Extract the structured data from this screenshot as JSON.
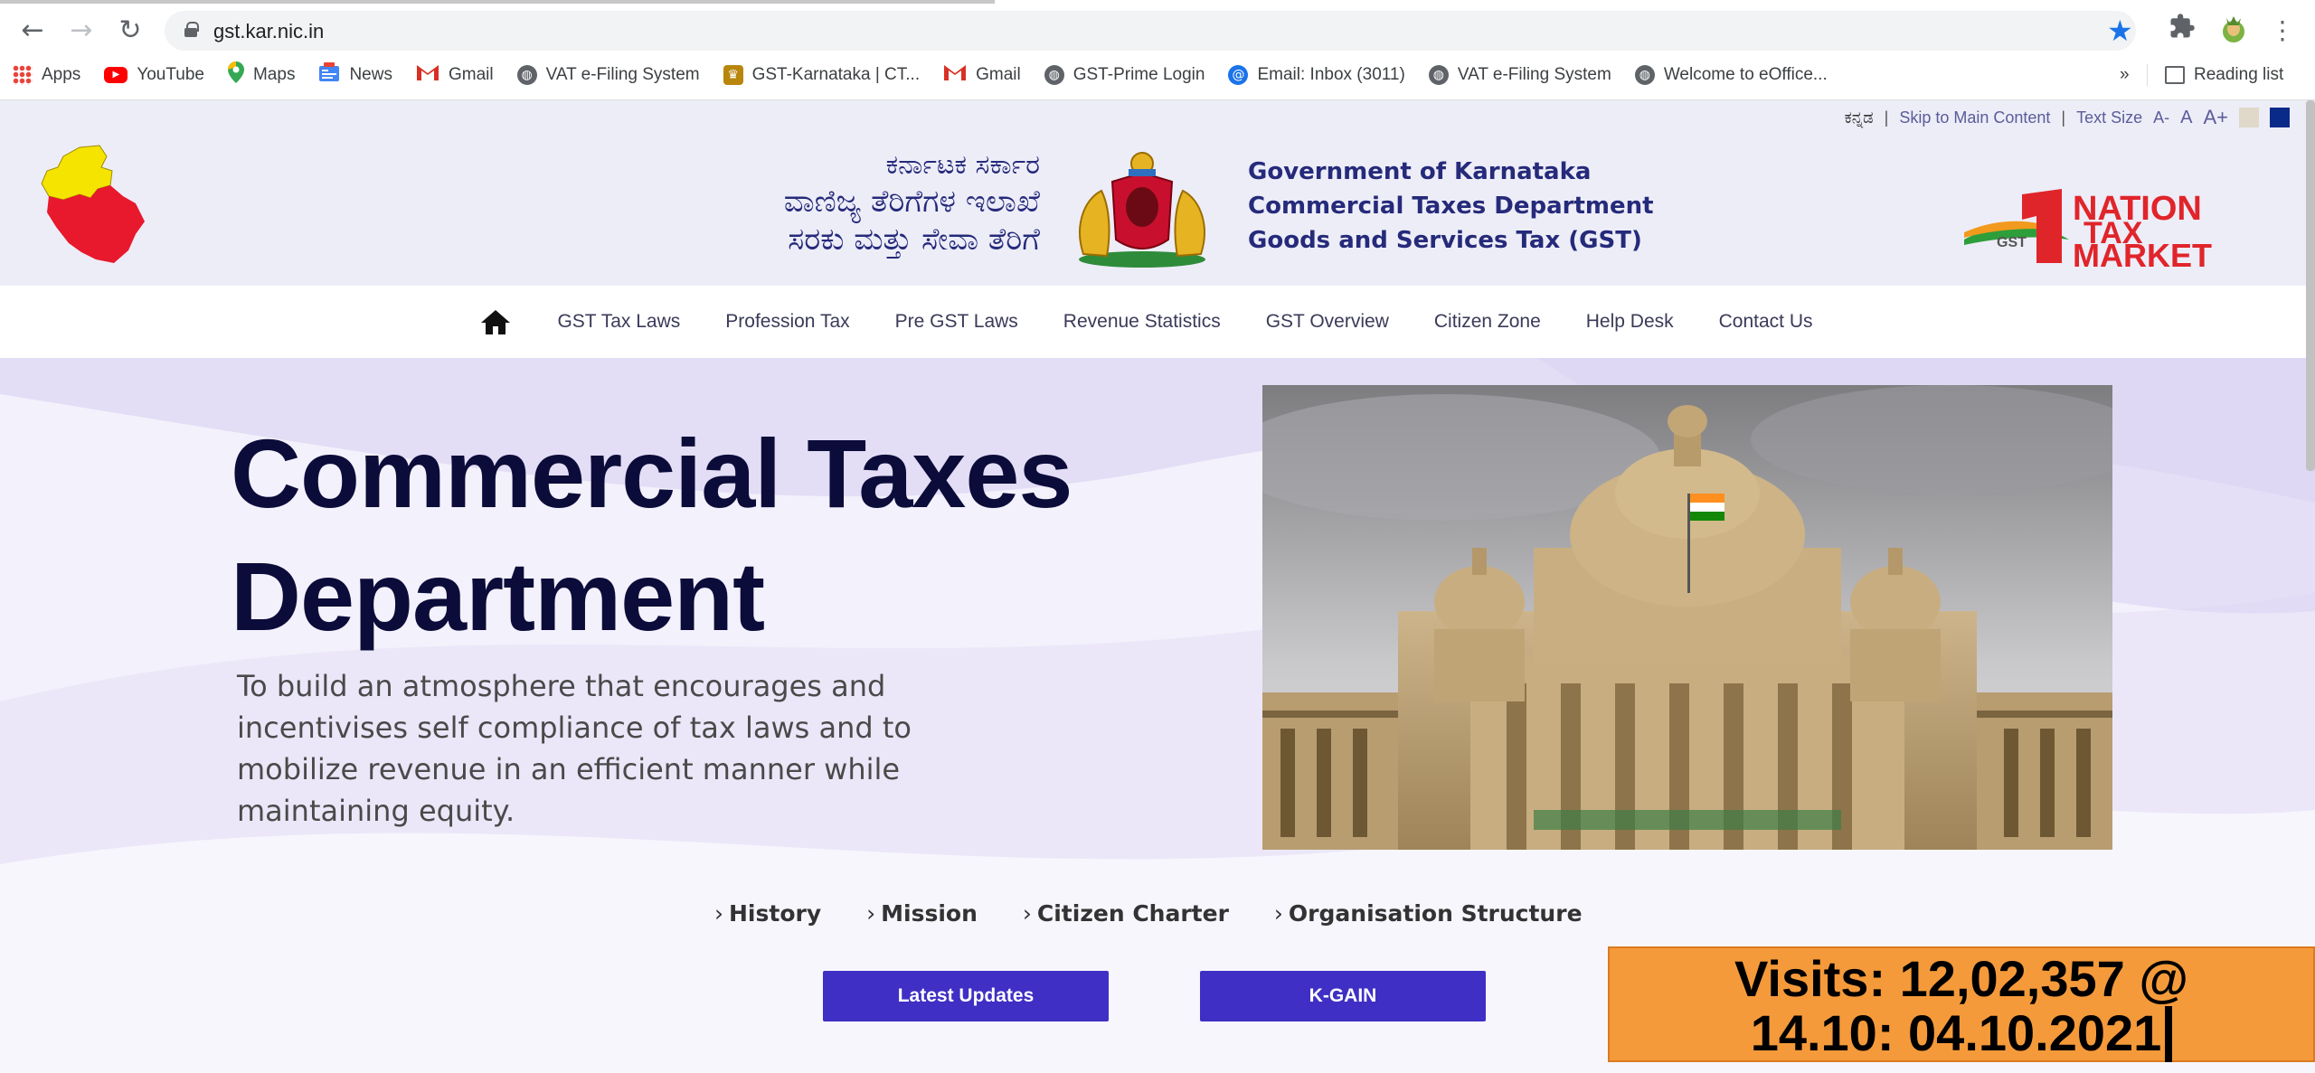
{
  "browser": {
    "url": "gst.kar.nic.in",
    "bookmarks": [
      {
        "label": "Apps",
        "icon": "apps-grid-icon",
        "color": "#e8453c"
      },
      {
        "label": "YouTube",
        "icon": "youtube-icon",
        "color": "#ff0000"
      },
      {
        "label": "Maps",
        "icon": "maps-pin-icon",
        "color": "#34a853"
      },
      {
        "label": "News",
        "icon": "news-icon",
        "color": "#4285f4"
      },
      {
        "label": "Gmail",
        "icon": "gmail-icon",
        "color": "#d93025"
      },
      {
        "label": "VAT e-Filing System",
        "icon": "globe-icon",
        "color": "#5f6368"
      },
      {
        "label": "GST-Karnataka | CT...",
        "icon": "karnataka-emblem-icon",
        "color": "#b8860b"
      },
      {
        "label": "Gmail",
        "icon": "gmail-icon",
        "color": "#d93025"
      },
      {
        "label": "GST-Prime Login",
        "icon": "globe-icon",
        "color": "#5f6368"
      },
      {
        "label": "Email: Inbox (3011)",
        "icon": "email-icon",
        "color": "#1a73e8"
      },
      {
        "label": "VAT e-Filing System",
        "icon": "globe-icon",
        "color": "#5f6368"
      },
      {
        "label": "Welcome to eOffice...",
        "icon": "globe-icon",
        "color": "#5f6368"
      }
    ],
    "more": "»",
    "reading_list": "Reading list"
  },
  "utility": {
    "kannada": "ಕನ್ನಡ",
    "sep": "|",
    "skip": "Skip to Main Content",
    "text_size": "Text Size",
    "a_minus": "A-",
    "a": "A",
    "a_plus": "A+",
    "theme_colors": [
      "#e0d8c8",
      "#0a2a8a"
    ]
  },
  "header": {
    "kn_line1": "ಕರ್ನಾಟಕ ಸರ್ಕಾರ",
    "kn_line2": "ವಾಣಿಜ್ಯ ತೆರಿಗೆಗಳ ಇಲಾಖೆ",
    "kn_line3": "ಸರಕು ಮತ್ತು ಸೇವಾ ತೆರಿಗೆ",
    "en_line1": "Government of Karnataka",
    "en_line2": "Commercial Taxes Department",
    "en_line3": "Goods and Services Tax (GST)",
    "ntm_line1": "NATION",
    "ntm_line2": "TAX",
    "ntm_line3": "MARKET",
    "ntm_digit": "1",
    "ntm_gst": "GST"
  },
  "menu": [
    "GST Tax Laws",
    "Profession Tax",
    "Pre GST Laws",
    "Revenue Statistics",
    "GST Overview",
    "Citizen Zone",
    "Help Desk",
    "Contact Us"
  ],
  "hero": {
    "title1": "Commercial Taxes",
    "title2": "Department",
    "mission": "To build an atmosphere that encourages and incentivises self compliance of tax laws and to mobilize revenue in an efficient manner while maintaining equity.",
    "links": [
      "History",
      "Mission",
      "Citizen Charter",
      "Organisation Structure"
    ],
    "chevron": "›",
    "btn_updates": "Latest Updates",
    "btn_kgain": "K-GAIN"
  },
  "overlay": {
    "line1": "Visits: 12,02,357 @",
    "line2": "14.10: 04.10.2021"
  }
}
